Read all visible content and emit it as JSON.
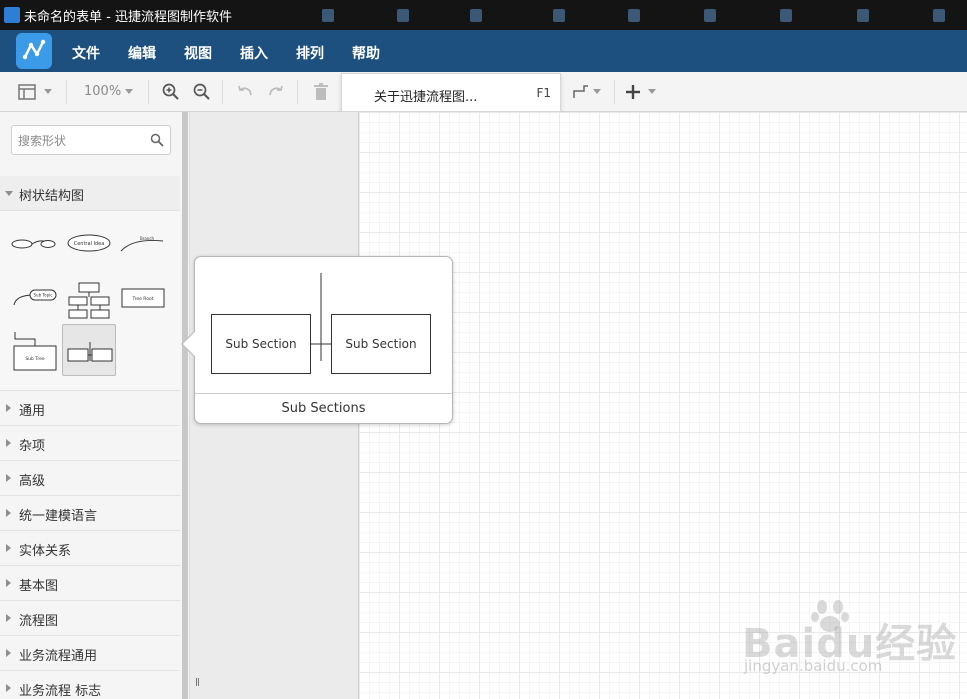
{
  "window": {
    "title": "未命名的表单 - 迅捷流程图制作软件"
  },
  "menu": {
    "items": [
      "文件",
      "编辑",
      "视图",
      "插入",
      "排列",
      "帮助"
    ]
  },
  "toolbar": {
    "zoom": "100%"
  },
  "dropdown": {
    "label": "关于迅捷流程图...",
    "shortcut": "F1"
  },
  "sidebar": {
    "search_placeholder": "搜索形状",
    "expanded_section": "树状结构图",
    "sections": [
      "通用",
      "杂项",
      "高级",
      "统一建模语言",
      "实体关系",
      "基本图",
      "流程图",
      "业务流程通用",
      "业务流程 标志"
    ],
    "shape_labels": {
      "centralidea": "Central Idea",
      "branch": "Branch",
      "subtopic": "Sub Topic",
      "treeroot": "Tree Root",
      "subtree": "Sub Tree"
    }
  },
  "preview": {
    "caption": "Sub Sections",
    "left_box": "Sub Section",
    "right_box": "Sub Section"
  },
  "watermark": {
    "text": "Baidu经验",
    "url": "jingyan.baidu.com"
  }
}
